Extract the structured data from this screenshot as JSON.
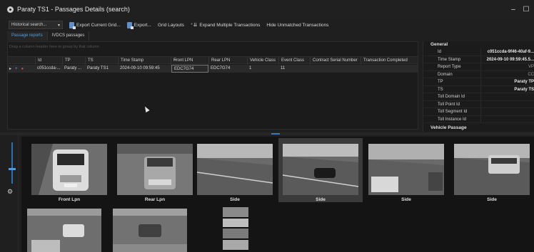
{
  "window": {
    "title": "Paraty TS1 - Passages Details (search)",
    "minimize": "–",
    "maximize": "☐"
  },
  "toolbar": {
    "search_select": "Historical search...",
    "export_grid": "Export Current Grid...",
    "export": "Export...",
    "grid_layouts": "Grid Layouts",
    "expand_multiple": "Expand Multiple Transactions",
    "hide_unmatched": "Hide Unmatched Transactions"
  },
  "tabs": [
    {
      "label": "Passage reports"
    },
    {
      "label": "IVDCS passages"
    }
  ],
  "grid": {
    "group_hint": "Drag a column header here to group by that column",
    "columns": [
      "Id",
      "TP",
      "TS",
      "Time Stamp",
      "Front LPN",
      "Rear LPN",
      "Vehicle Class",
      "Event Class",
      "Contract Serial Number",
      "Transaction Completed"
    ],
    "rows": [
      {
        "id": "c051ccda-...",
        "tp": "Paraty ...",
        "ts": "Paraty TS1",
        "timestamp": "2024-09-10 09:59:45",
        "front_lpn": "EDC7G74",
        "rear_lpn": "EDC7G74",
        "vehicle_class": "1",
        "event_class": "11",
        "contract": "",
        "completed": ""
      }
    ]
  },
  "properties": {
    "section_general": "General",
    "rows": [
      {
        "label": "Id",
        "value": "c051ccda-9f46-40af-9..."
      },
      {
        "label": "Time Stamp",
        "value": "2024-09-10 09:59:45.5..."
      },
      {
        "label": "Report Type",
        "value": "VP"
      },
      {
        "label": "Domain",
        "value": "CC"
      },
      {
        "label": "TP",
        "value": "Paraty TP"
      },
      {
        "label": "TS",
        "value": "Paraty TS"
      },
      {
        "label": "Toll Domain Id",
        "value": ""
      },
      {
        "label": "Toll Point Id",
        "value": ""
      },
      {
        "label": "Toll Segment Id",
        "value": ""
      },
      {
        "label": "Toll Instance Id",
        "value": ""
      }
    ],
    "section_vehicle": "Vehicle Passage"
  },
  "images": [
    {
      "label": "Front Lpn",
      "selected": false
    },
    {
      "label": "Rear Lpn",
      "selected": false
    },
    {
      "label": "Side",
      "selected": false
    },
    {
      "label": "Side",
      "selected": true
    },
    {
      "label": "Side",
      "selected": false
    },
    {
      "label": "Side",
      "selected": false
    }
  ],
  "colors": {
    "accent": "#4fa3e6",
    "selected_thumb": "#3b3b3b"
  }
}
